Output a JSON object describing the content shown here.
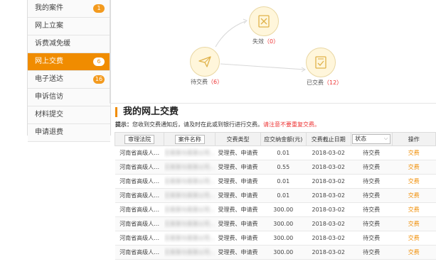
{
  "sidebar": {
    "items": [
      {
        "label": "我的案件",
        "badge": "1",
        "active": false
      },
      {
        "label": "网上立案",
        "badge": "",
        "active": false
      },
      {
        "label": "诉费减免缓",
        "badge": "",
        "active": false
      },
      {
        "label": "网上交费",
        "badge": "6",
        "active": true
      },
      {
        "label": "电子送达",
        "badge": "16",
        "active": false
      },
      {
        "label": "申诉信访",
        "badge": "",
        "active": false
      },
      {
        "label": "材料提交",
        "badge": "",
        "active": false
      },
      {
        "label": "申请退费",
        "badge": "",
        "active": false
      }
    ]
  },
  "flow": {
    "failed": {
      "label": "失效",
      "count": "（0）"
    },
    "pending": {
      "label": "待交费",
      "count": "（6）"
    },
    "paid": {
      "label": "已交费",
      "count": "（12）"
    }
  },
  "section": {
    "title": "我的网上交费",
    "notice_prefix": "提示：",
    "notice_text": "您收到交费通知后，请及时在此或到银行进行交费。",
    "notice_warning": "请注意不要重复交费。"
  },
  "table": {
    "headers": [
      "审理法院",
      "案件名称",
      "交费类型",
      "应交纳金额(元)",
      "交费截止日期",
      "状态",
      "操作"
    ],
    "status_select": "状态",
    "rows": [
      {
        "court": "河南省高级人…",
        "case": "王某某与某某公司…",
        "type": "受理费、申请费",
        "amount": "0.01",
        "deadline": "2018-03-02",
        "status": "待交费",
        "action": "交费"
      },
      {
        "court": "河南省高级人…",
        "case": "王某某与某某公司…",
        "type": "受理费、申请费",
        "amount": "0.55",
        "deadline": "2018-03-02",
        "status": "待交费",
        "action": "交费"
      },
      {
        "court": "河南省高级人…",
        "case": "王某某与某某公司…",
        "type": "受理费、申请费",
        "amount": "0.01",
        "deadline": "2018-03-02",
        "status": "待交费",
        "action": "交费"
      },
      {
        "court": "河南省高级人…",
        "case": "王某某与某某公司…",
        "type": "受理费、申请费",
        "amount": "0.01",
        "deadline": "2018-03-02",
        "status": "待交费",
        "action": "交费"
      },
      {
        "court": "河南省高级人…",
        "case": "王某某与某某公司…",
        "type": "受理费、申请费",
        "amount": "300.00",
        "deadline": "2018-03-02",
        "status": "待交费",
        "action": "交费"
      },
      {
        "court": "河南省高级人…",
        "case": "王某某与某某公司…",
        "type": "受理费、申请费",
        "amount": "300.00",
        "deadline": "2018-03-02",
        "status": "待交费",
        "action": "交费"
      },
      {
        "court": "河南省高级人…",
        "case": "王某某与某某公司…",
        "type": "受理费、申请费",
        "amount": "300.00",
        "deadline": "2018-03-02",
        "status": "待交费",
        "action": "交费"
      },
      {
        "court": "河南省高级人…",
        "case": "王某某与某某公司…",
        "type": "受理费、申请费",
        "amount": "300.00",
        "deadline": "2018-03-02",
        "status": "待交费",
        "action": "交费"
      }
    ]
  },
  "colors": {
    "accent": "#f08c00",
    "warning": "#e33333",
    "node_fill": "#fff6db"
  },
  "icons": [
    "paper-plane-icon",
    "invalid-doc-icon",
    "paid-doc-icon",
    "chevron-down-icon"
  ]
}
